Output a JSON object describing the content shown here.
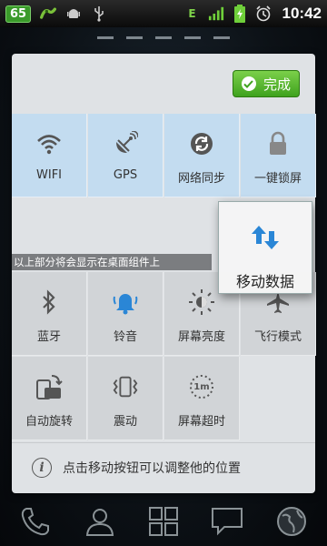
{
  "status_bar": {
    "battery_level": "65",
    "network_type": "E",
    "time": "10:42",
    "icons": [
      "battery-badge",
      "app-notification-icon",
      "android-icon",
      "usb-icon",
      "edge-signal-icon",
      "signal-bars-icon",
      "battery-charging-icon",
      "alarm-icon"
    ]
  },
  "panel": {
    "done_button_label": "完成",
    "hint_strip_text": "以上部分将会显示在桌面组件上",
    "tiles": [
      {
        "label": "WIFI",
        "icon": "wifi-icon"
      },
      {
        "label": "GPS",
        "icon": "gps-dish-icon"
      },
      {
        "label": "网络同步",
        "icon": "sync-icon"
      },
      {
        "label": "一键锁屏",
        "icon": "lock-icon"
      },
      {
        "label": "蓝牙",
        "icon": "bluetooth-icon"
      },
      {
        "label": "铃音",
        "icon": "ringer-icon"
      },
      {
        "label": "屏幕亮度",
        "icon": "brightness-icon"
      },
      {
        "label": "飞行模式",
        "icon": "airplane-icon"
      },
      {
        "label": "自动旋转",
        "icon": "rotate-icon"
      },
      {
        "label": "震动",
        "icon": "vibrate-icon"
      },
      {
        "label": "屏幕超时",
        "icon": "screen-timeout-icon"
      }
    ],
    "timeout_icon_text": "1m",
    "floating_tile": {
      "label": "移动数据",
      "icon": "mobile-data-arrows-icon"
    },
    "info_text": "点击移动按钮可以调整他的位置"
  },
  "dock": {
    "items": [
      "phone-icon",
      "contacts-icon",
      "apps-grid-icon",
      "messages-icon",
      "browser-globe-icon"
    ]
  },
  "colors": {
    "accent_green": "#3fa21e",
    "tile_blue": "#c3dcf0",
    "tile_gray": "#d1d4d7",
    "icon_blue": "#2a86d6"
  }
}
